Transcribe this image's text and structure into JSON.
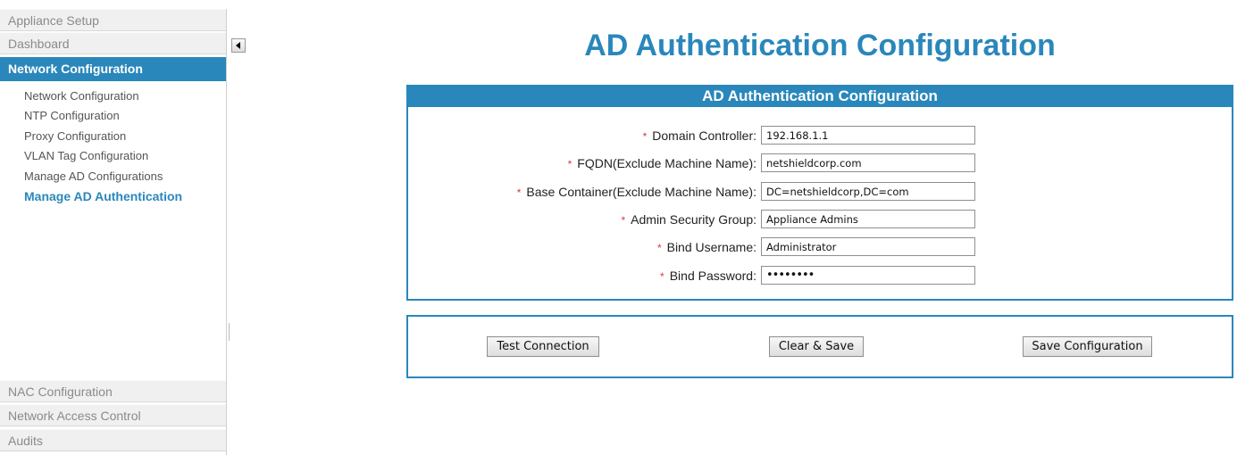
{
  "sidebar": {
    "sections": {
      "appliance_setup": "Appliance Setup",
      "dashboard": "Dashboard",
      "network_configuration": "Network Configuration",
      "nac_configuration": "NAC Configuration",
      "network_access_control": "Network Access Control",
      "audits": "Audits"
    },
    "items": [
      {
        "label": "Network Configuration"
      },
      {
        "label": "NTP Configuration"
      },
      {
        "label": "Proxy Configuration"
      },
      {
        "label": "VLAN Tag Configuration"
      },
      {
        "label": "Manage AD Configurations"
      },
      {
        "label": "Manage AD Authentication"
      }
    ]
  },
  "main": {
    "title": "AD Authentication Configuration",
    "panel_title": "AD Authentication Configuration",
    "required_mark": "*",
    "fields": [
      {
        "label": "Domain Controller:",
        "value": "192.168.1.1"
      },
      {
        "label": "FQDN(Exclude Machine Name):",
        "value": "netshieldcorp.com"
      },
      {
        "label": "Base Container(Exclude Machine Name):",
        "value": "DC=netshieldcorp,DC=com"
      },
      {
        "label": "Admin Security Group:",
        "value": "Appliance Admins"
      },
      {
        "label": "Bind Username:",
        "value": "Administrator"
      },
      {
        "label": "Bind Password:",
        "value": "••••••••"
      }
    ],
    "buttons": {
      "test": "Test Connection",
      "clear_save": "Clear & Save",
      "save": "Save Configuration"
    }
  },
  "colors": {
    "accent": "#2a87bb",
    "required": "#d23c3c"
  }
}
